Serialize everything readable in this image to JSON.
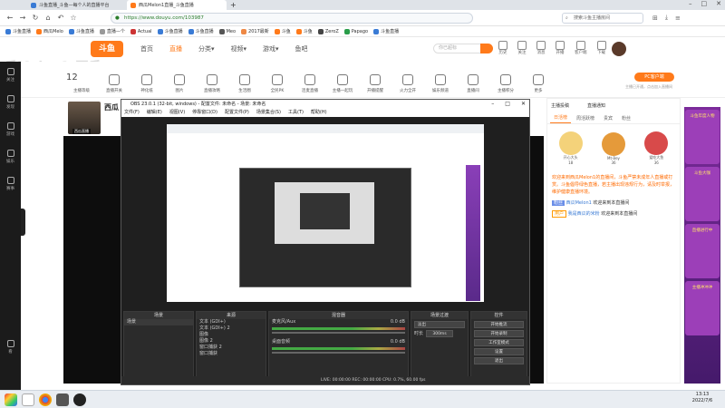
{
  "browser": {
    "tabs": [
      {
        "label": "斗鱼直播_斗鱼—每个人的直播平台",
        "active": false,
        "color": "#3a7bd5"
      },
      {
        "label": "西瓜Melon1直播_斗鱼直播",
        "active": true,
        "color": "#ff7a1a"
      }
    ],
    "new_tab": "+",
    "url": "https://www.douyu.com/103987",
    "search_placeholder": "搜索斗鱼主播房间",
    "bookmarks": [
      "斗鱼直播",
      "西瓜Melo",
      "斗鱼直播",
      "直播—个",
      "Actual",
      "斗鱼直播",
      "斗鱼直播",
      "Meo",
      "2017最新",
      "斗鱼",
      "斗鱼",
      "ZeroZ",
      "Papago",
      "斗鱼直播"
    ]
  },
  "douyu": {
    "logo": "斗鱼",
    "nav": [
      {
        "label": "首页",
        "active": false
      },
      {
        "label": "直播",
        "active": true
      },
      {
        "label": "分类▾",
        "active": false
      },
      {
        "label": "视频▾",
        "active": false
      },
      {
        "label": "游戏▾",
        "active": false
      },
      {
        "label": "鱼吧",
        "active": false
      }
    ],
    "search_placeholder": "你已超标",
    "header_icons": [
      "历史",
      "关注",
      "消息",
      "开播",
      "客户端",
      "下载"
    ],
    "watermark": "瓜Melon1_西瓜",
    "sidebar": [
      "关注",
      "发现",
      "游戏",
      "娱乐",
      "赛事",
      "看"
    ],
    "categories": [
      "主播等级",
      "直播开关",
      "神化纸",
      "图片",
      "直播攻略",
      "生活圈",
      "全民PK",
      "连麦直播",
      "主播一起玩",
      "开播提醒",
      "火力全开",
      "娱乐频道",
      "直播间",
      "主播积分",
      "更多"
    ],
    "level": "12",
    "pc_button": "PC客户端",
    "pc_sub": "主播已开通，点击加入直播间"
  },
  "room": {
    "name": "西瓜",
    "anchor_label": "西瓜直播"
  },
  "right_panel": {
    "tabs": [
      {
        "label": "日活榜",
        "active": true
      },
      {
        "label": "周活跃榜",
        "active": false
      },
      {
        "label": "贵宾",
        "active": false
      },
      {
        "label": "粉丝",
        "active": false
      }
    ],
    "header": "主播投稿",
    "header2": "直播通知",
    "ranking": [
      {
        "name": "开心大头",
        "level": "18"
      },
      {
        "name": "Mt·Bey",
        "level": "36"
      },
      {
        "name": "爱吃大鱼",
        "level": "36"
      }
    ],
    "notice": "欢迎来到西瓜Melon1的直播间，斗鱼严禁未成年人直播或打赏。斗鱼倡导绿色直播，若主播出现违规行为，请及时举报，维护健康直播环境。",
    "chat": [
      {
        "badge": "粉丝",
        "user": "西瓜Melon1",
        "text": "欢迎来到本直播间"
      },
      {
        "badge": "用户",
        "user": "我是西瓜的米粉",
        "text": "欢迎来到本直播间"
      }
    ]
  },
  "ads": [
    "斗鱼年度人物",
    "斗鱼大咖",
    "直播进行中",
    "主播冲冲冲"
  ],
  "obs": {
    "title": "OBS 23.0.1 (32-bit, windows) - 配置文件: 未命名 - 场景: 未命名",
    "menu": [
      "文件(F)",
      "编辑(E)",
      "视图(V)",
      "停靠窗口(D)",
      "配置文件(P)",
      "场景集合(S)",
      "工具(T)",
      "帮助(H)"
    ],
    "docks": [
      {
        "title": "场景",
        "items": [
          "场景"
        ]
      },
      {
        "title": "来源",
        "items": [
          "文本 (GDI+)",
          "文本 (GDI+) 2",
          "图像",
          "图像 2",
          "窗口捕获 2",
          "窗口捕获"
        ]
      },
      {
        "title": "混音器",
        "items": [
          "麦克风/Aux",
          "桌面音频"
        ]
      },
      {
        "title": "场景过渡",
        "items": [
          "淡出",
          "时长"
        ],
        "duration": "300ms"
      },
      {
        "title": "控件",
        "items": [
          "开始推流",
          "开始录制",
          "工作室模式",
          "设置",
          "退出"
        ]
      }
    ],
    "levels": [
      "0.0 dB",
      "0.0 dB"
    ],
    "status": "LIVE: 00:00:00   REC: 00:00:00   CPU: 0.7%, 60.00 fps"
  },
  "taskbar": {
    "time": "13:13",
    "date": "2022/7/6"
  }
}
